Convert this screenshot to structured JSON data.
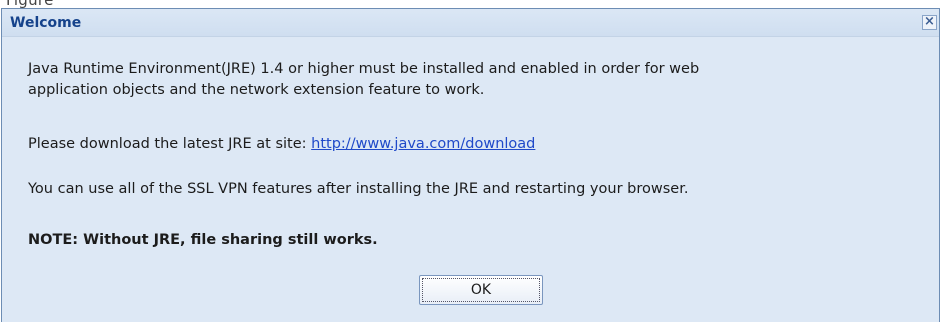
{
  "window": {
    "title": "Welcome",
    "close_icon": "close-icon"
  },
  "top_fragment": "Figure",
  "message": {
    "line1": "Java Runtime Environment(JRE) 1.4 or higher must be installed and enabled in order for web",
    "line2": "application objects and the network extension feature to work.",
    "download_prefix": "Please download the latest JRE at site: ",
    "download_link": "http://www.java.com/download",
    "vpn_note": "You can use all of the SSL VPN features after installing the JRE and restarting your browser.",
    "note": "NOTE: Without JRE, file sharing still works."
  },
  "buttons": {
    "ok_label": "OK"
  },
  "colors": {
    "dialog_background": "#dde8f5",
    "title_color": "#15428b",
    "link_color": "#1f49c9",
    "border_color": "#6d8db4"
  }
}
